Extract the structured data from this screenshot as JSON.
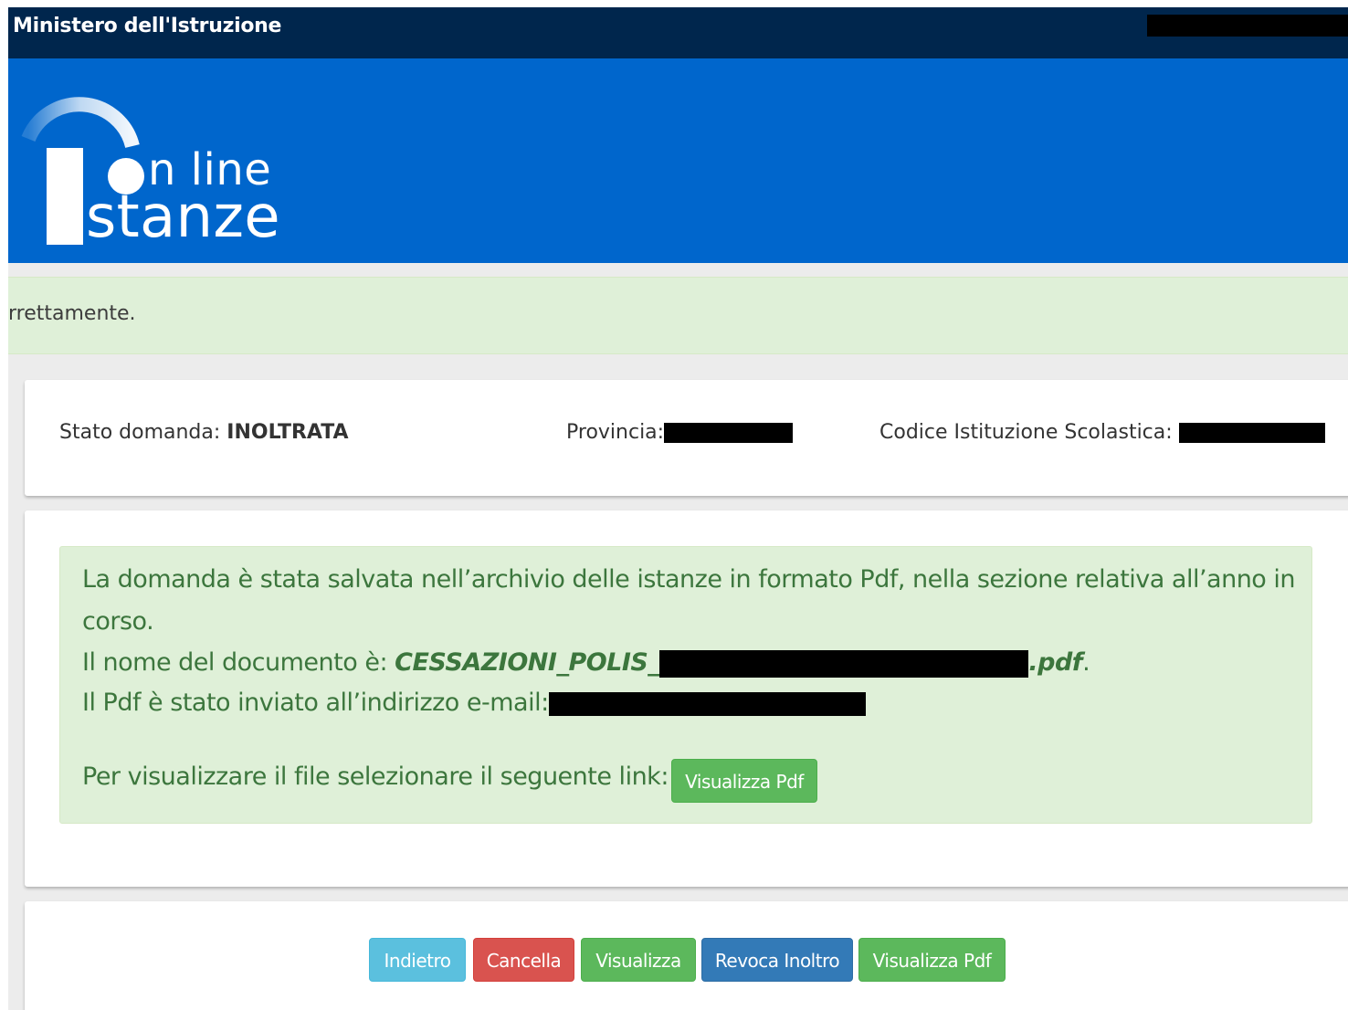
{
  "header": {
    "ministry": "Ministero dell'Istruzione"
  },
  "logo": {
    "line1": "n line",
    "line2": "stanze"
  },
  "alert_top": {
    "text": "rrettamente."
  },
  "status": {
    "stato_label": "Stato domanda:",
    "stato_value": "INOLTRATA",
    "provincia_label": "Provincia:",
    "codice_label": "Codice Istituzione Scolastica:"
  },
  "message": {
    "line1": "La domanda è stata salvata nell’archivio delle istanze in formato Pdf, nella sezione relativa all’anno in",
    "line2": "corso.",
    "doc_prefix": "Il nome del documento è:",
    "doc_name_start": "CESSAZIONI_POLIS_",
    "doc_name_end": ".pdf",
    "doc_suffix": ".",
    "email_prefix": "Il Pdf è stato inviato all’indirizzo e-mail:",
    "link_prefix": "Per visualizzare il file selezionare il seguente link:",
    "link_button": "Visualizza Pdf"
  },
  "actions": {
    "indietro": "Indietro",
    "cancella": "Cancella",
    "visualizza": "Visualizza",
    "revoca": "Revoca Inoltro",
    "visualizza_pdf": "Visualizza Pdf"
  },
  "colors": {
    "topbar": "#00264d",
    "brand_blue": "#0066cc",
    "success_bg": "#dff0d8",
    "success_text": "#3c763d",
    "btn_success": "#5cb85c",
    "btn_info": "#5bc0de",
    "btn_danger": "#d9534f",
    "btn_primary": "#337ab7"
  }
}
